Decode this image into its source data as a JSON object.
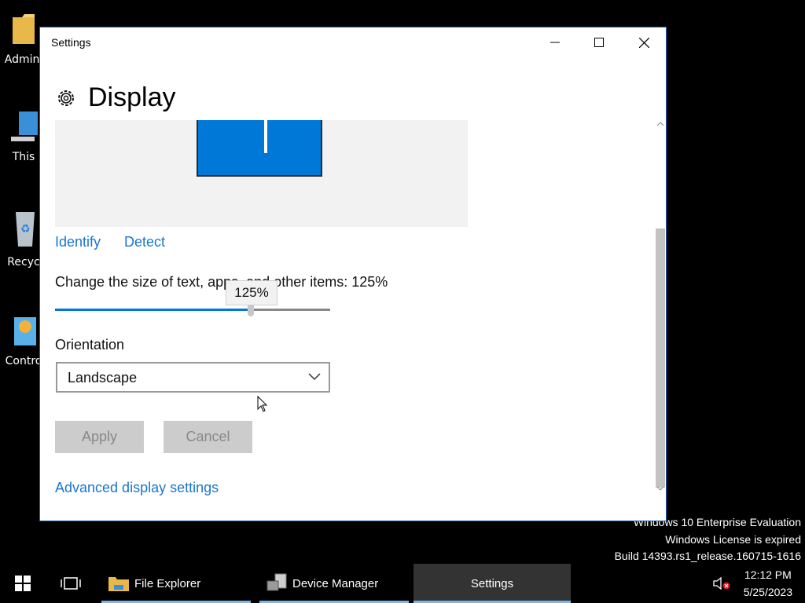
{
  "desktop": {
    "icons": [
      {
        "label": "Admini",
        "icon": "folder-icon"
      },
      {
        "label": "This",
        "icon": "computer-icon"
      },
      {
        "label": "Recyc",
        "icon": "recycle-bin-icon"
      },
      {
        "label": "Contro",
        "icon": "control-panel-icon"
      }
    ],
    "watermark": {
      "line1": "Windows 10 Enterprise Evaluation",
      "line2": "Windows License is expired",
      "line3": "Build 14393.rs1_release.160715-1616"
    }
  },
  "window": {
    "title": "Settings",
    "header_title": "Display",
    "identify_label": "Identify",
    "detect_label": "Detect",
    "scale_label": "Change the size of text, apps, and other items: 125%",
    "scale_tooltip": "125%",
    "scale_value_fraction": 0.71,
    "orientation_label": "Orientation",
    "orientation_value": "Landscape",
    "apply_label": "Apply",
    "cancel_label": "Cancel",
    "advanced_link": "Advanced display settings"
  },
  "taskbar": {
    "items": [
      {
        "label": "File Explorer",
        "icon": "folder-icon"
      },
      {
        "label": "Device Manager",
        "icon": "device-manager-icon"
      },
      {
        "label": "Settings",
        "active": true
      }
    ],
    "time": "12:12 PM",
    "date": "5/25/2023"
  },
  "colors": {
    "accent": "#0078d7",
    "link": "#1976d2",
    "taskbar_underline": "#76b9ed"
  }
}
